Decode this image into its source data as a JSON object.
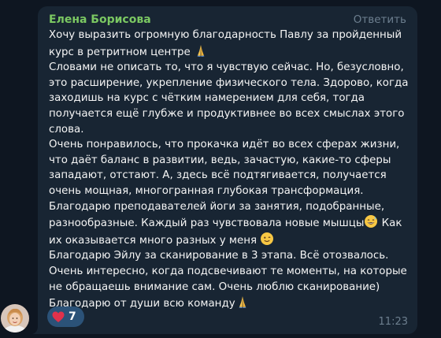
{
  "message": {
    "sender_name": "Елена Борисова",
    "reply_label": "Ответить",
    "paragraphs": [
      {
        "text": "Хочу выразить огромную благодарность Павлу за пройденный\nкурс в ретритном центре ",
        "emoji": "praying-hands"
      },
      {
        "text": "\nСловами не описать то, что я чувствую сейчас. Но, безусловно,\nэто расширение, укрепление физического тела. Здорово, когда\nзаходишь на курс с чётким намерением для себя, тогда\nполучается ещё глубже и продуктивнее во всех смыслах этого\nслова.\nОчень понравилось, что прокачка идёт во всех сферах жизни,\nчто даёт баланс в развитии, ведь, зачастую, какие-то сферы\nзападают, отстают. А, здесь всё подтягивается, получается\nочень мощная, многогранная глубокая трансформация.\nБлагодарю преподавателей йоги за занятия, подобранные,\nразнообразные. Каждый раз чувствовала новые мышцы",
        "emoji": "grinning-sweat"
      },
      {
        "text": " Как\nих оказывается много разных у меня ",
        "emoji": "winking"
      },
      {
        "text": "\nБлагодарю Эйлу за сканирование в 3 этапа. Всё отозвалось.\nОчень интересно, когда подсвечивают те моменты, на которые\nне обращаешь внимание сам. Очень люблю сканирование)\nБлагодарю от души всю команду",
        "emoji": "praying-hands"
      }
    ],
    "reaction": {
      "emoji": "red-heart",
      "count": "7"
    },
    "time": "11:23"
  },
  "colors": {
    "background": "#0e1621",
    "bubble": "#182533",
    "sender_name": "#7bc862",
    "muted": "#6d7f8f",
    "reaction_bg": "#2b5278",
    "heart": "#e0314b"
  }
}
